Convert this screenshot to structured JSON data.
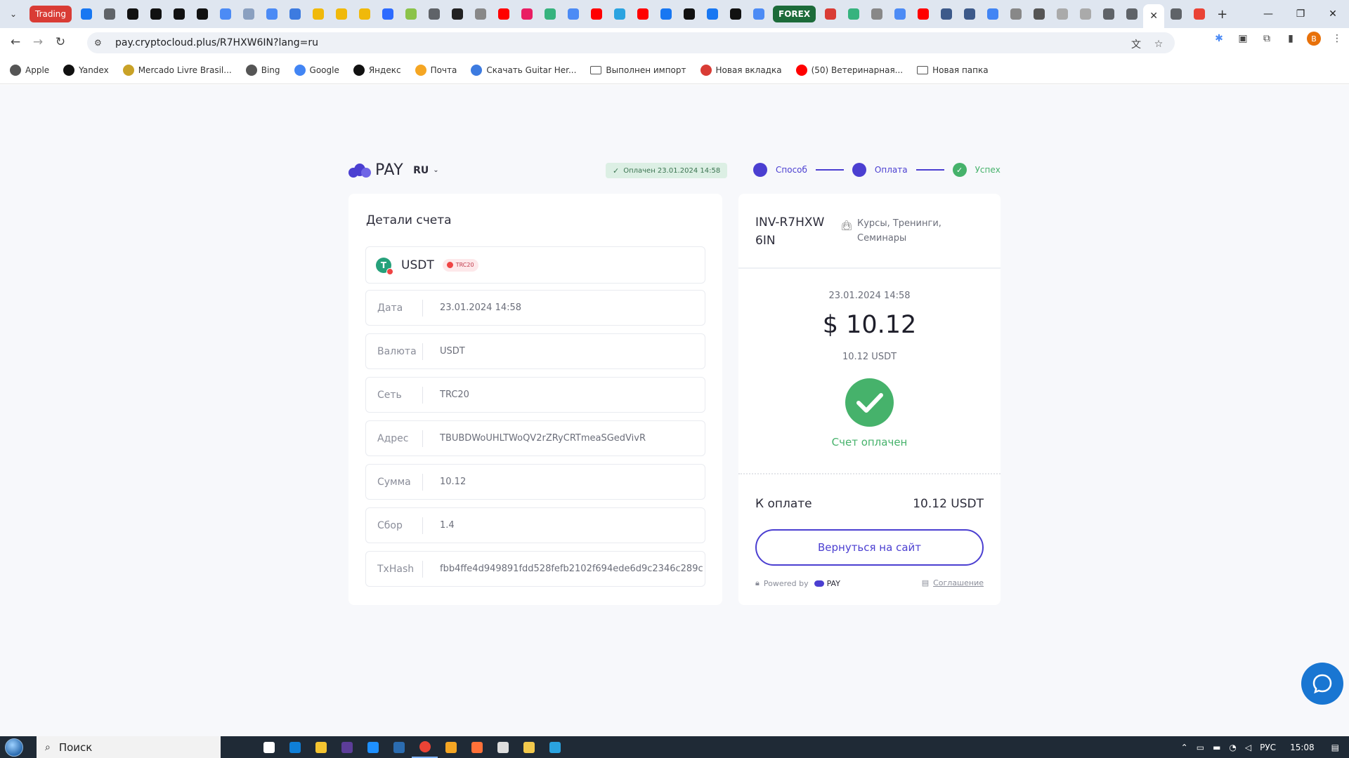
{
  "browser": {
    "tab_pill_trading": "Trading",
    "tab_pill_forex": "FOREX",
    "active_tab_close": "✕",
    "new_tab": "+",
    "tab_icon_colors": [
      "#1877f2",
      "#5f6368",
      "#111111",
      "#111111",
      "#111111",
      "#111111",
      "#4c8bf5",
      "#8aa0c0",
      "#4c8bf5",
      "#3d7be0",
      "#f0b90b",
      "#f0b90b",
      "#f0b90b",
      "#2d6bff",
      "#8bc34a",
      "#5f6368",
      "#222222",
      "#888888",
      "#ff0000",
      "#e91e63",
      "#36b37e",
      "#4c8bf5",
      "#ff0000",
      "#2aa3e0",
      "#ff0000",
      "#1877f2",
      "#111111",
      "#1877f2",
      "#111111",
      "#4c8bf5"
    ],
    "tab_icon_colors_after_forex": [
      "#d93c35",
      "#36b37e",
      "#888888",
      "#4c8bf5",
      "#ff0000",
      "#3d5a8a",
      "#3d5a8a",
      "#4285f4",
      "#888888",
      "#555555",
      "#aaaaaa",
      "#aaaaaa",
      "#5f6368",
      "#5f6368"
    ],
    "tab_icon_after_active": [
      "#5f6368",
      "#ea4335"
    ],
    "window_controls": [
      "—",
      "❐",
      "✕"
    ],
    "url": "pay.cryptocloud.plus/R7HXW6IN?lang=ru"
  },
  "bookmarks": [
    {
      "label": "Apple",
      "icon": "apple-icon",
      "color": "#555555"
    },
    {
      "label": "Yandex",
      "icon": "plus-circle-icon",
      "color": "#111111"
    },
    {
      "label": "Mercado Livre Brasil...",
      "icon": "mercado-icon",
      "color": "#c9a227"
    },
    {
      "label": "Bing",
      "icon": "globe-icon",
      "color": "#555555"
    },
    {
      "label": "Google",
      "icon": "google-icon",
      "color": "#4285f4"
    },
    {
      "label": "Яндекс",
      "icon": "plus-circle-icon",
      "color": "#111111"
    },
    {
      "label": "Почта",
      "icon": "mail-icon",
      "color": "#f5a623"
    },
    {
      "label": "Скачать Guitar Her...",
      "icon": "bird-icon",
      "color": "#3d7be0"
    },
    {
      "label": "Выполнен импорт",
      "icon": "folder-icon",
      "color": "#555555"
    },
    {
      "label": "Новая вкладка",
      "icon": "calendar-icon",
      "color": "#d93c35"
    },
    {
      "label": "(50) Ветеринарная...",
      "icon": "youtube-icon",
      "color": "#ff0000"
    },
    {
      "label": "Новая папка",
      "icon": "folder-icon",
      "color": "#555555"
    }
  ],
  "header": {
    "brand": "PAY",
    "lang": "RU",
    "paid_badge": "Оплачен 23.01.2024 14:58",
    "steps": [
      {
        "label": "Способ",
        "state": "active"
      },
      {
        "label": "Оплата",
        "state": "active"
      },
      {
        "label": "Успех",
        "state": "done"
      }
    ]
  },
  "details": {
    "title": "Детали счета",
    "coin": "USDT",
    "network_tag": "TRC20",
    "rows": [
      {
        "label": "Дата",
        "value": "23.01.2024 14:58"
      },
      {
        "label": "Валюта",
        "value": "USDT"
      },
      {
        "label": "Сеть",
        "value": "TRC20"
      },
      {
        "label": "Адрес",
        "value": "TBUBDWoUHLTWoQV2rZRyCRTmeaSGedVivR"
      },
      {
        "label": "Сумма",
        "value": "10.12"
      },
      {
        "label": "Сбор",
        "value": "1.4"
      },
      {
        "label": "TxHash",
        "value": "fbb4ffe4d949891fdd528fefb2102f694ede6d9c2346c289c"
      }
    ]
  },
  "invoice": {
    "id": "INV-R7HXW6IN",
    "category": "Курсы, Тренинги, Семинары",
    "date": "23.01.2024 14:58",
    "amount": "$ 10.12",
    "amount_crypto": "10.12 USDT",
    "status": "Счет оплачен",
    "to_pay_label": "К оплате",
    "to_pay_value": "10.12 USDT",
    "back_button": "Вернуться на сайт",
    "powered_by": "Powered by",
    "powered_brand": "PAY",
    "agreement": "Соглашение"
  },
  "taskbar": {
    "search_placeholder": "Поиск",
    "lang": "РУС",
    "time": "15:08",
    "app_icon_colors": [
      "#ffffff",
      "#0f7fd8",
      "#f4c430",
      "#5c3d99",
      "#1e90ff",
      "#2b6cb0",
      "#ea4335",
      "#f5a623",
      "#ff7139",
      "#dddddd",
      "#f2c94c",
      "#2aa3e0"
    ]
  },
  "colors": {
    "accent": "#4b3fd1",
    "success": "#46b26b",
    "page_bg": "#f7f8fb"
  }
}
